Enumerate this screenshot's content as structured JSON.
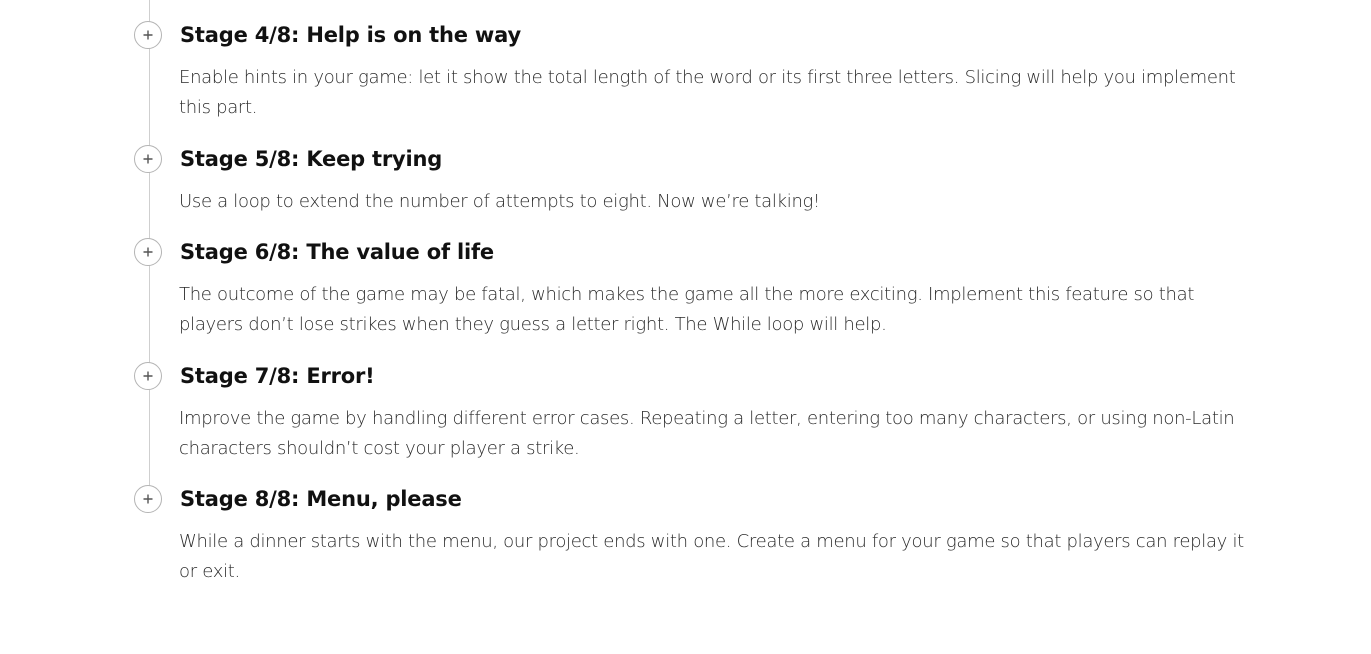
{
  "stages": [
    {
      "title": "Stage 4/8: Help is on the way",
      "description": "Enable hints in your game: let it show the total length of the word or its first three letters. Slicing will help you implement this part."
    },
    {
      "title": "Stage 5/8: Keep trying",
      "description": "Use a loop to extend the number of attempts to eight. Now we’re talking!"
    },
    {
      "title": "Stage 6/8: The value of life",
      "description": "The outcome of the game may be fatal, which makes the game all the more exciting. Implement this feature so that players don’t lose strikes when they guess a letter right. The While loop will help."
    },
    {
      "title": "Stage 7/8: Error!",
      "description": "Improve the game by handling different error cases. Repeating a letter, entering too many characters, or using non-Latin characters shouldn’t cost your player a strike."
    },
    {
      "title": "Stage 8/8: Menu, please",
      "description": "While a dinner starts with the menu, our project ends with one. Create a menu for your game so that players can replay it or exit."
    }
  ],
  "icons": {
    "toggle": "plus-icon"
  },
  "colors": {
    "text": "#1d1d1d",
    "line": "#cfcfcf",
    "toggle_border": "#b4b4b4"
  }
}
